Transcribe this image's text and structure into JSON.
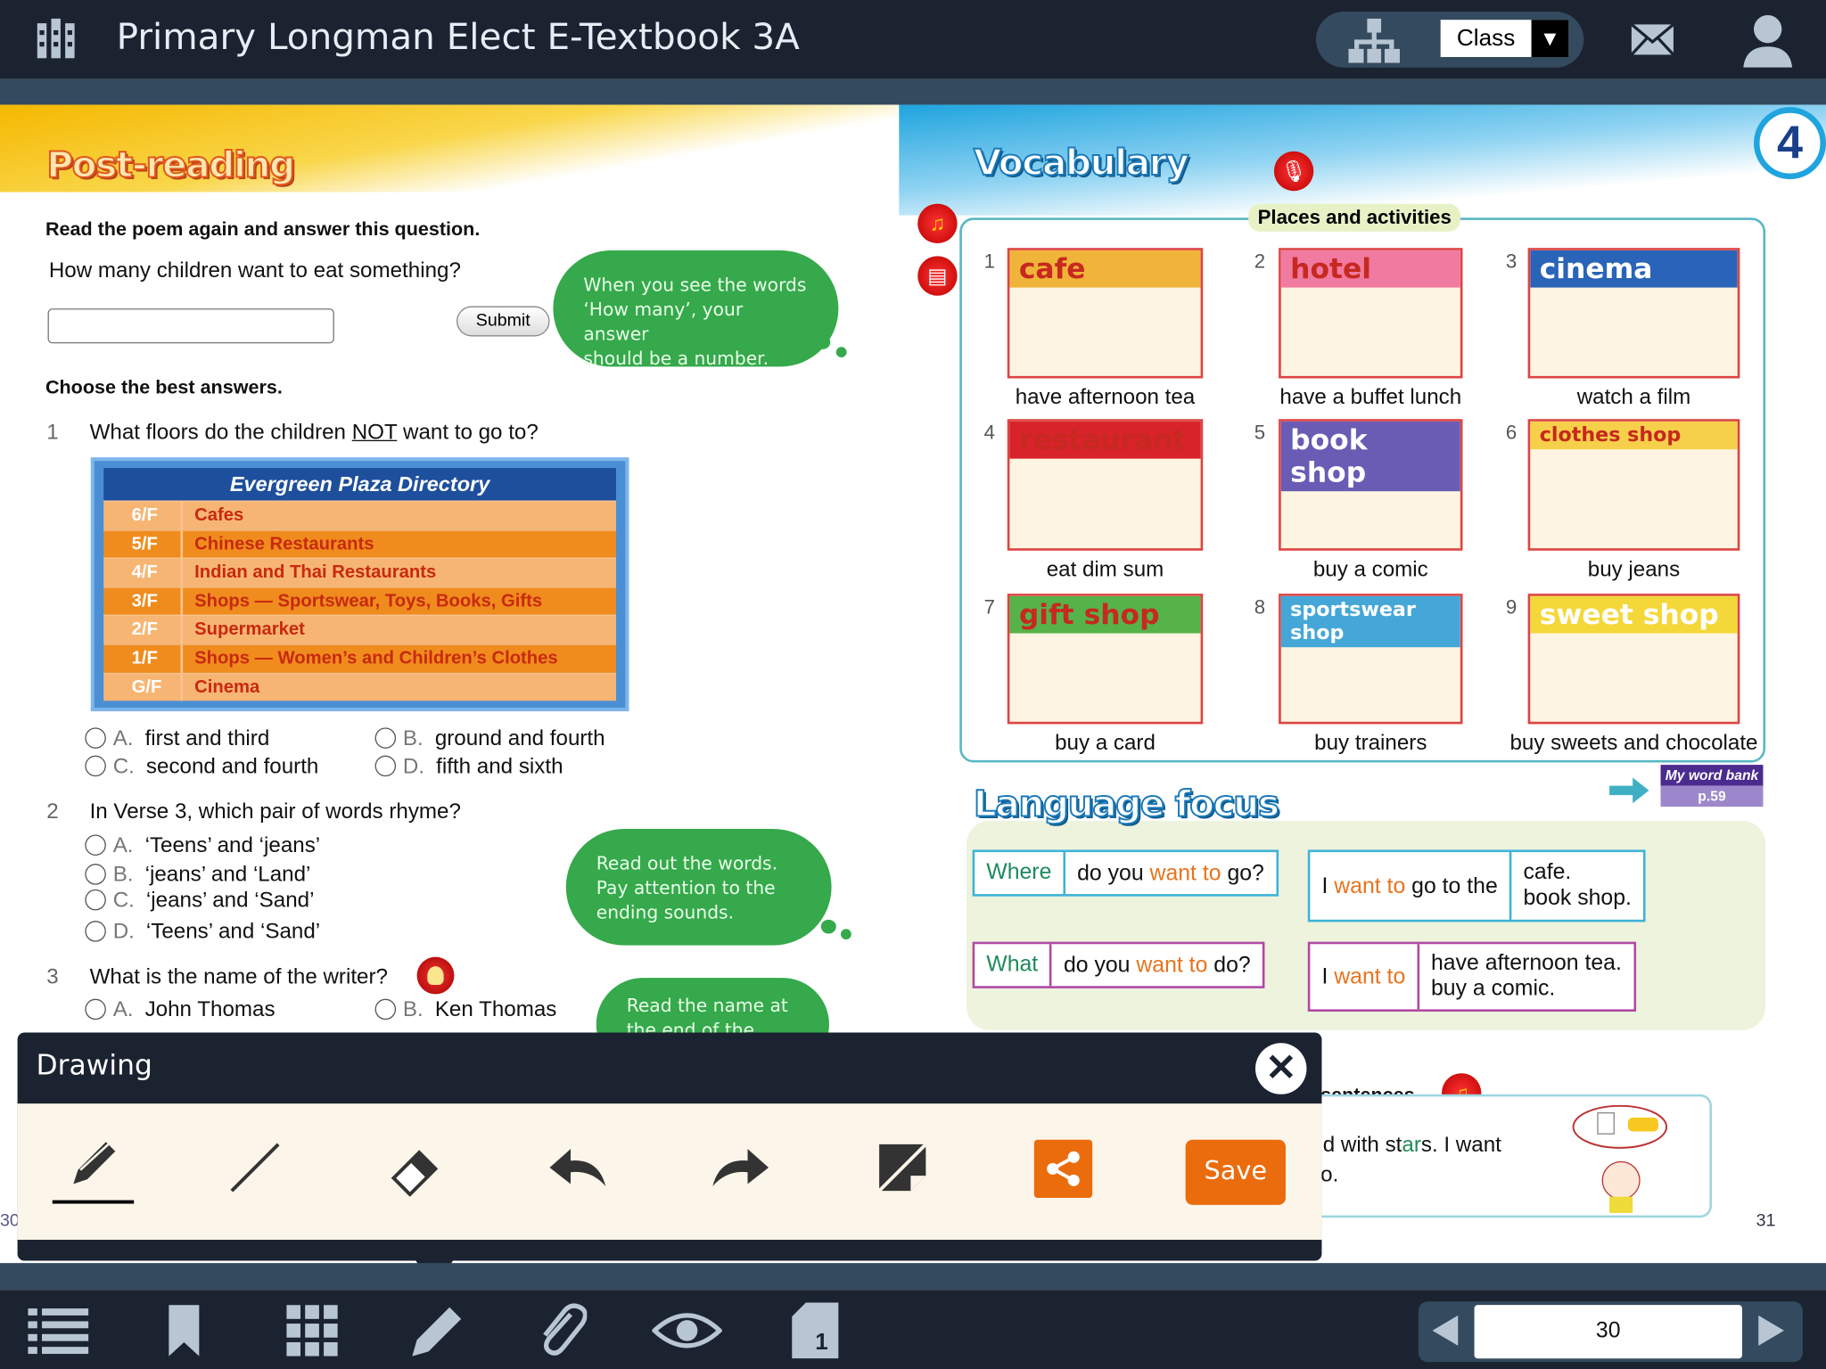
{
  "header": {
    "title": "Primary Longman Elect E-Textbook 3A",
    "class_select": "Class",
    "icons": [
      "library-icon",
      "hierarchy-icon",
      "mail-icon",
      "user-icon"
    ]
  },
  "left_page": {
    "banner": "Post-reading",
    "instruction1": "Read the poem again and answer this question.",
    "question_main": "How many children want to eat something?",
    "answer_value": "",
    "submit_label": "Submit",
    "tip1": [
      "When you see the words",
      "‘How many’, your answer",
      "should be a number."
    ],
    "instruction2": "Choose the best answers.",
    "q1": {
      "num": "1",
      "text_pre": "What floors do the children ",
      "text_em": "NOT",
      "text_post": " want to go to?",
      "options": [
        {
          "l": "A.",
          "t": "first and third"
        },
        {
          "l": "B.",
          "t": "ground and fourth"
        },
        {
          "l": "C.",
          "t": "second and fourth"
        },
        {
          "l": "D.",
          "t": "fifth and sixth"
        }
      ]
    },
    "directory": {
      "title": "Evergreen Plaza Directory",
      "rows": [
        {
          "floor": "6/F",
          "name": "Cafes"
        },
        {
          "floor": "5/F",
          "name": "Chinese Restaurants"
        },
        {
          "floor": "4/F",
          "name": "Indian and Thai Restaurants"
        },
        {
          "floor": "3/F",
          "name": "Shops — Sportswear, Toys, Books, Gifts"
        },
        {
          "floor": "2/F",
          "name": "Supermarket"
        },
        {
          "floor": "1/F",
          "name": "Shops — Women’s and Children’s Clothes"
        },
        {
          "floor": "G/F",
          "name": "Cinema"
        }
      ]
    },
    "q2": {
      "num": "2",
      "text": "In Verse 3, which pair of words rhyme?",
      "options": [
        {
          "l": "A.",
          "t": "‘Teens’ and ‘jeans’"
        },
        {
          "l": "B.",
          "t": "‘jeans’ and ‘Land’"
        },
        {
          "l": "C.",
          "t": "‘jeans’ and ‘Sand’"
        },
        {
          "l": "D.",
          "t": "‘Teens’ and ‘Sand’"
        }
      ]
    },
    "tip2": [
      "Read out the words.",
      "Pay attention to the",
      "ending sounds."
    ],
    "q3": {
      "num": "3",
      "text": "What is the name of the writer?",
      "options": [
        {
          "l": "A.",
          "t": "John Thomas"
        },
        {
          "l": "B.",
          "t": "Ken Thomas"
        }
      ]
    },
    "tip3": [
      "Read the name at",
      "the end of the poem."
    ],
    "page_number": "30"
  },
  "right_page": {
    "unit_number": "4",
    "banner": "Vocabulary",
    "section_title": "Places and activities",
    "items": [
      {
        "num": "1",
        "sign": "cafe",
        "caption": "have afternoon tea",
        "color": "#f0b43a"
      },
      {
        "num": "2",
        "sign": "hotel",
        "caption": "have a buffet lunch",
        "color": "#f07aa0"
      },
      {
        "num": "3",
        "sign": "cinema",
        "caption": "watch a film",
        "color": "#2a64b8"
      },
      {
        "num": "4",
        "sign": "restaurant",
        "caption": "eat dim sum",
        "color": "#d8232a"
      },
      {
        "num": "5",
        "sign": "book shop",
        "caption": "buy a comic",
        "color": "#6a5bb5"
      },
      {
        "num": "6",
        "sign": "clothes shop",
        "caption": "buy jeans",
        "color": "#f6d04a"
      },
      {
        "num": "7",
        "sign": "gift shop",
        "caption": "buy a card",
        "color": "#56b34a"
      },
      {
        "num": "8",
        "sign": "sportswear shop",
        "caption": "buy trainers",
        "color": "#44a7d8"
      },
      {
        "num": "9",
        "sign": "sweet shop",
        "caption": "buy sweets and chocolate",
        "color": "#f4d83a"
      }
    ],
    "word_bank": {
      "label": "My word bank",
      "page": "p.59"
    },
    "lang_banner": "Language focus",
    "lf": {
      "where": "Where",
      "q1_pre": "do you ",
      "q1_want": "want to",
      "q1_post": " go?",
      "a1_pre": "I ",
      "a1_want": "want to",
      "a1_post": " go to the",
      "a1_opt1": "cafe.",
      "a1_opt2": "book shop.",
      "what": "What",
      "q2_pre": "do you ",
      "q2_want": "want to",
      "q2_post": " do?",
      "a2_pre": "I ",
      "a2_want": "want to",
      "a2_opt1": "have afternoon tea.",
      "a2_opt2": "buy a comic."
    },
    "partial_instruction": "sentences.",
    "partial_line1_pre": "d with st",
    "partial_line1_hl": "ar",
    "partial_line1_post": "s. I want",
    "partial_line2": "o.",
    "page_number": "31",
    "left_margin_number": "30"
  },
  "drawing_panel": {
    "title": "Drawing",
    "tools": [
      "pencil-icon",
      "line-icon",
      "eraser-icon",
      "undo-icon",
      "redo-icon",
      "clear-icon",
      "share-icon"
    ],
    "active_tool": "pencil-icon",
    "save_label": "Save"
  },
  "bottom_bar": {
    "tools": [
      "contents-icon",
      "bookmark-icon",
      "thumbnails-icon",
      "pen-icon",
      "attachment-icon",
      "eye-icon",
      "page-jump-icon"
    ],
    "page_value": "30"
  }
}
